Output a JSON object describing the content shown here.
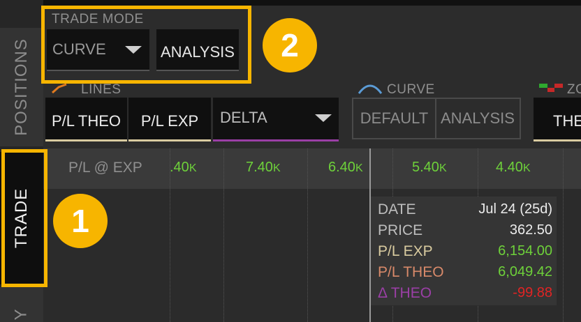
{
  "side_tabs": {
    "positions": "POSITIONS",
    "trade": "TRADE",
    "next": "Y"
  },
  "trade_mode": {
    "label": "TRADE MODE",
    "mode_value": "CURVE",
    "analysis_button": "ANALYSIS"
  },
  "lines": {
    "label": "LINES",
    "buttons": [
      "P/L THEO",
      "P/L EXP"
    ],
    "dropdown_value": "DELTA"
  },
  "curve": {
    "label": "CURVE",
    "buttons": [
      "DEFAULT",
      "ANALYSIS"
    ]
  },
  "zone": {
    "label": "ZO",
    "button": "THE"
  },
  "pl_exp_row": {
    "label": "P/L @ EXP",
    "values": [
      ".40",
      "7.40",
      "6.40",
      "5.40",
      "4.40"
    ],
    "unit": "K"
  },
  "tooltip": {
    "rows": [
      {
        "label": "DATE",
        "value": "Jul 24 (25d)"
      },
      {
        "label": "PRICE",
        "value": "362.50"
      },
      {
        "label": "P/L EXP",
        "value": "6,154.00"
      },
      {
        "label": "P/L THEO",
        "value": "6,049.42"
      },
      {
        "label": "Δ THEO",
        "value": "-99.88"
      }
    ]
  },
  "badges": {
    "one": "1",
    "two": "2"
  },
  "colors": {
    "highlight": "#f7b500",
    "positive": "#6ed13a",
    "negative": "#e02424",
    "delta": "#9b3fa6"
  }
}
